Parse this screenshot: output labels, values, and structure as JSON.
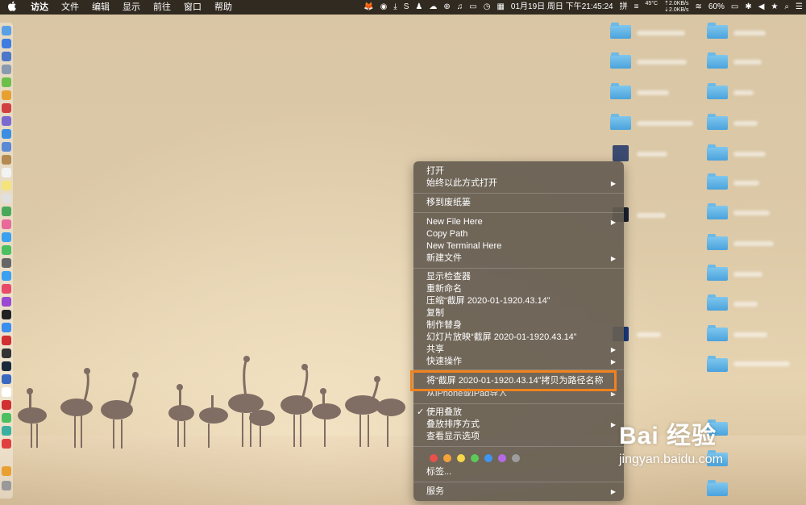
{
  "menubar": {
    "app": "访达",
    "items": [
      "文件",
      "编辑",
      "显示",
      "前往",
      "窗口",
      "帮助"
    ],
    "status": {
      "date_time": "01月19日 周日 下午21:45:24",
      "temp": "45°C",
      "net_up": "⇡2.0KB/s",
      "net_down": "⇣2.0KB/s",
      "battery": "60%"
    }
  },
  "context_menu": {
    "items": [
      {
        "label": "打开"
      },
      {
        "label": "始终以此方式打开",
        "submenu": true
      },
      {
        "label": "移到废纸篓"
      },
      {
        "label": "New File Here",
        "submenu": true
      },
      {
        "label": "Copy Path"
      },
      {
        "label": "New Terminal Here"
      },
      {
        "label": "新建文件",
        "submenu": true
      },
      {
        "label": "显示检查器"
      },
      {
        "label": "重新命名"
      },
      {
        "label": "压缩“截屏 2020-01-1920.43.14”"
      },
      {
        "label": "复制"
      },
      {
        "label": "制作替身"
      },
      {
        "label": "幻灯片放映“截屏 2020-01-1920.43.14”"
      },
      {
        "label": "共享",
        "submenu": true
      },
      {
        "label": "快速操作",
        "submenu": true
      },
      {
        "label": "将“截屏 2020-01-1920.43.14”拷贝为路径名称",
        "highlighted": true
      },
      {
        "label": "从iPhone或iPad导入",
        "submenu": true
      },
      {
        "label": "使用叠放",
        "checked": true
      },
      {
        "label": "叠放排序方式",
        "submenu": true
      },
      {
        "label": "查看显示选项"
      },
      {
        "label": "标签..."
      },
      {
        "label": "服务",
        "submenu": true
      }
    ],
    "tag_colors": [
      "#e8514a",
      "#f3a33a",
      "#f4d84a",
      "#5dca58",
      "#3f95f0",
      "#b46ae6",
      "#9d9d9d"
    ],
    "highlight_color": "#f0821e"
  },
  "watermark": {
    "logo": "Bai 经验",
    "url": "jingyan.baidu.com"
  }
}
